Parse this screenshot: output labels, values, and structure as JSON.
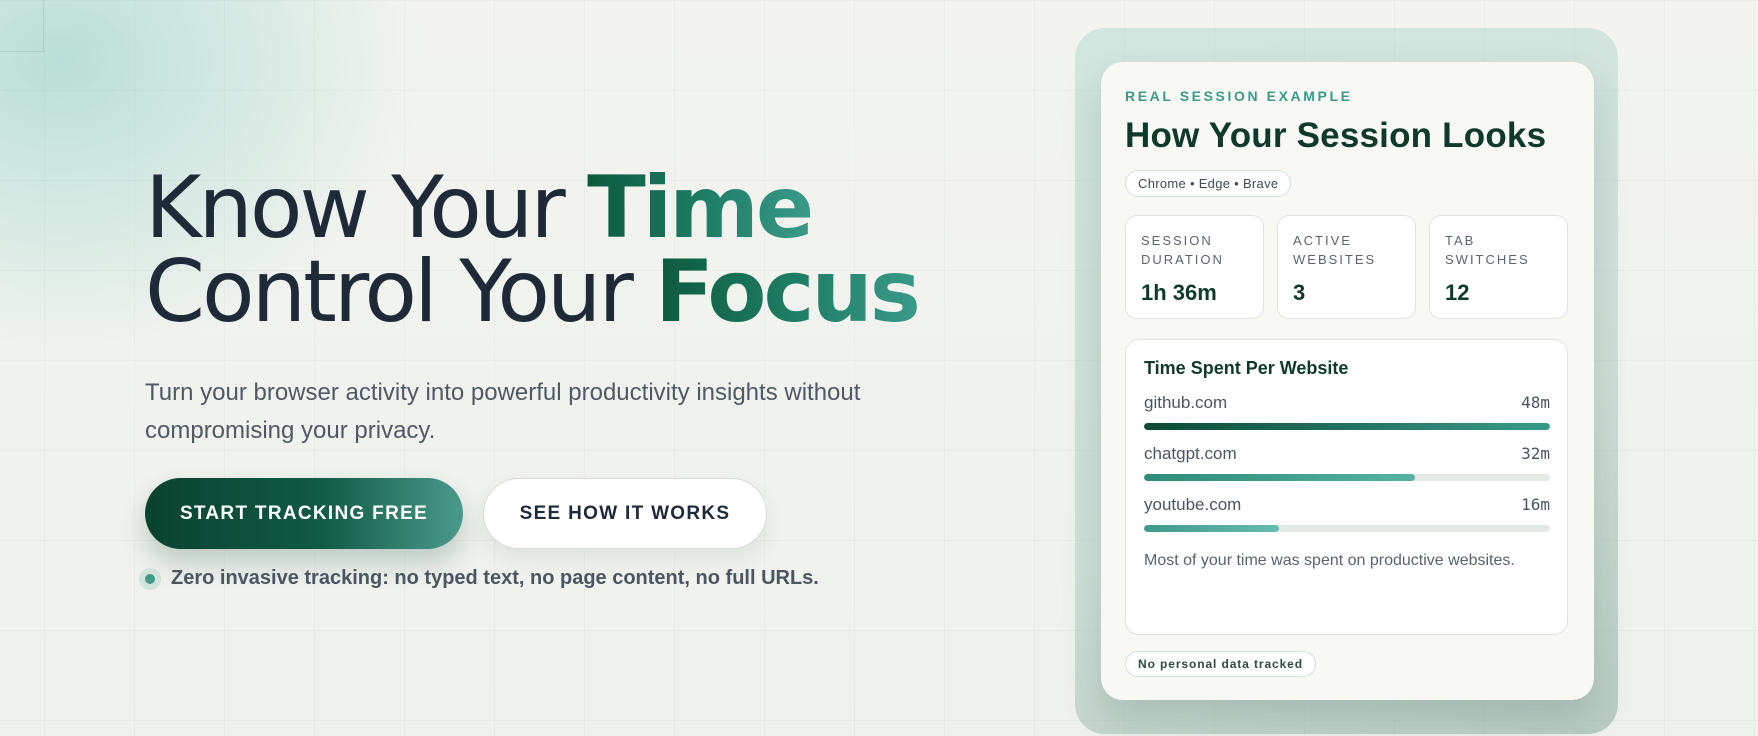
{
  "hero": {
    "line1_prefix": "Know Your ",
    "line1_highlight": "Time",
    "line2_prefix": "Control Your ",
    "line2_highlight": "Focus",
    "subtitle": "Turn your browser activity into powerful productivity insights without compromising your privacy.",
    "primary_cta": "START TRACKING FREE",
    "secondary_cta": "SEE HOW IT WORKS",
    "privacy_note": "Zero invasive tracking: no typed text, no page content, no full URLs."
  },
  "card": {
    "eyebrow": "REAL SESSION EXAMPLE",
    "title": "How Your Session Looks",
    "browsers": "Chrome • Edge • Brave",
    "stats": [
      {
        "label": "SESSION DURATION",
        "value": "1h 36m"
      },
      {
        "label": "ACTIVE WEBSITES",
        "value": "3"
      },
      {
        "label": "TAB SWITCHES",
        "value": "12"
      }
    ],
    "panel": {
      "title": "Time Spent Per Website",
      "sites": [
        {
          "name": "github.com",
          "time": "48m",
          "fraction": 1.0
        },
        {
          "name": "chatgpt.com",
          "time": "32m",
          "fraction": 0.667
        },
        {
          "name": "youtube.com",
          "time": "16m",
          "fraction": 0.333
        }
      ],
      "note": "Most of your time was spent on productive websites."
    },
    "footer_chip": "No personal data tracked"
  },
  "colors": {
    "accent_dark": "#0a4330",
    "accent": "#1f7f66",
    "accent_light": "#3a9a8a",
    "text_dark": "#1e2a38"
  }
}
